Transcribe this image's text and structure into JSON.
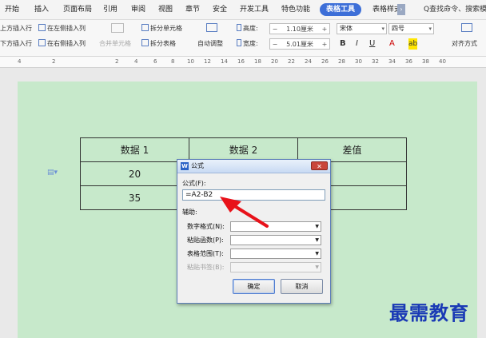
{
  "menubar": {
    "tabs": [
      "开始",
      "插入",
      "页面布局",
      "引用",
      "审阅",
      "视图",
      "章节",
      "安全",
      "开发工具",
      "特色功能"
    ],
    "active_tab": "表格工具",
    "next_tab": "表格样式",
    "overflow": "›",
    "search": "Q查找命令、搜索模板"
  },
  "ribbon": {
    "insert_above": "上方插入行",
    "insert_below": "下方插入行",
    "insert_left": "在左侧插入列",
    "insert_right": "在右侧插入列",
    "merge_cells": "合并单元格",
    "split_cells": "拆分单元格",
    "split_table": "拆分表格",
    "auto_fit": "自动调整",
    "height_label": "高度:",
    "height_value": "1.10厘米",
    "width_label": "宽度:",
    "width_value": "5.01厘米",
    "font_name": "宋体",
    "font_size": "四号",
    "bold": "B",
    "italic": "I",
    "underline": "U",
    "font_color": "A",
    "highlight": "ab",
    "align": "对齐方式",
    "minus": "−",
    "plus": "+"
  },
  "ruler": [
    "4",
    "2",
    "2",
    "4",
    "6",
    "8",
    "10",
    "12",
    "14",
    "16",
    "18",
    "20",
    "22",
    "24",
    "26",
    "28",
    "30",
    "32",
    "34",
    "36",
    "38",
    "40"
  ],
  "table": {
    "headers": [
      "数据 1",
      "数据 2",
      "差值"
    ],
    "rows": [
      [
        "20",
        "",
        ""
      ],
      [
        "35",
        "",
        ""
      ]
    ]
  },
  "dialog": {
    "logo": "W",
    "title": "公式",
    "close": "✕",
    "formula_label": "公式(F):",
    "formula_value": "=A2-B2",
    "aux_label": "辅助:",
    "number_format_label": "数字格式(N):",
    "paste_function_label": "粘贴函数(P):",
    "table_range_label": "表格范围(T):",
    "paste_bookmark_label": "粘贴书签(B):",
    "ok_label": "确定",
    "cancel_label": "取消"
  },
  "annotation": {
    "arrow_color": "#e8121a"
  },
  "watermark": "最需教育",
  "colors": {
    "page_bg": "#c7e9cb",
    "active_tab": "#3d6fd8",
    "watermark": "#1a3ab5"
  }
}
